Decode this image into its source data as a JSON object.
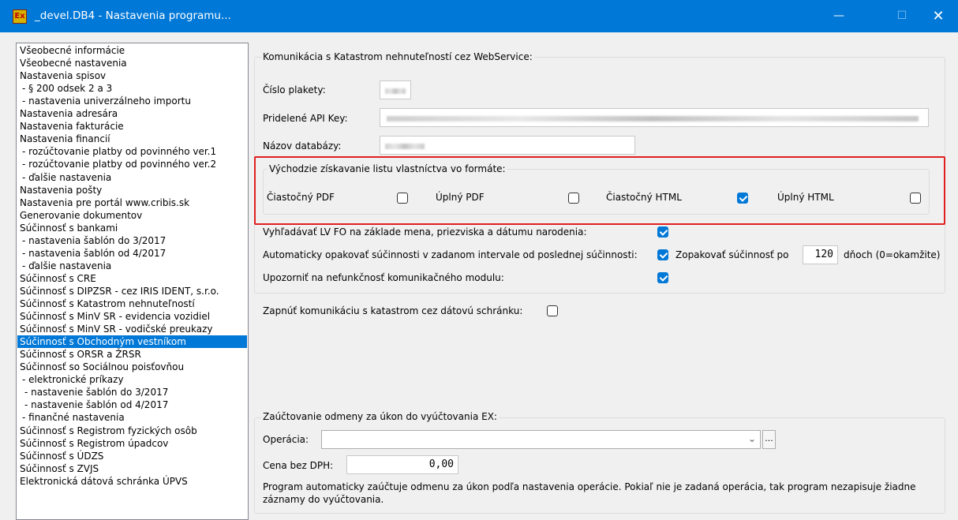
{
  "window": {
    "title": "_devel.DB4 - Nastavenia programu...",
    "icon_text": "Ex",
    "minimize_glyph": "—",
    "maximize_glyph": "☐",
    "close_glyph": "✕"
  },
  "tree": {
    "selected_index": 23,
    "items": [
      {
        "label": "Všeobecné informácie",
        "indent": 0
      },
      {
        "label": "Všeobecné nastavenia",
        "indent": 0
      },
      {
        "label": "Nastavenia spisov",
        "indent": 0
      },
      {
        "label": "- § 200 odsek 2 a 3",
        "indent": 1
      },
      {
        "label": "- nastavenia univerzálneho importu",
        "indent": 1
      },
      {
        "label": "Nastavenia adresára",
        "indent": 0
      },
      {
        "label": "Nastavenia fakturácie",
        "indent": 0
      },
      {
        "label": "Nastavenia financií",
        "indent": 0
      },
      {
        "label": "- rozúčtovanie platby od povinného ver.1",
        "indent": 1
      },
      {
        "label": "- rozúčtovanie platby od povinného ver.2",
        "indent": 1
      },
      {
        "label": "- ďalšie nastavenia",
        "indent": 1
      },
      {
        "label": "Nastavenia pošty",
        "indent": 0
      },
      {
        "label": "Nastavenia pre portál www.cribis.sk",
        "indent": 0
      },
      {
        "label": "Generovanie dokumentov",
        "indent": 0
      },
      {
        "label": "Súčinnosť s bankami",
        "indent": 0
      },
      {
        "label": "- nastavenia šablón do 3/2017",
        "indent": 1
      },
      {
        "label": "- nastavenia šablón od 4/2017",
        "indent": 1
      },
      {
        "label": "- ďalšie nastavenia",
        "indent": 1
      },
      {
        "label": "Súčinnosť s CRE",
        "indent": 0
      },
      {
        "label": "Súčinnosť s DIPZSR - cez IRIS IDENT, s.r.o.",
        "indent": 0
      },
      {
        "label": "Súčinnosť s Katastrom nehnuteľností",
        "indent": 0
      },
      {
        "label": "Súčinnosť s MinV SR - evidencia vozidiel",
        "indent": 0
      },
      {
        "label": "Súčinnosť s MinV SR - vodičské preukazy",
        "indent": 0
      },
      {
        "label": "Súčinnosť s Obchodným vestníkom",
        "indent": 0
      },
      {
        "label": "Súčinnosť s ORSR a ŽRSR",
        "indent": 0
      },
      {
        "label": "Súčinnosť so Sociálnou poisťovňou",
        "indent": 0
      },
      {
        "label": "- elektronické príkazy",
        "indent": 1
      },
      {
        "label": "- nastavenie šablón do 3/2017",
        "indent": 2
      },
      {
        "label": "- nastavenie šablón od 4/2017",
        "indent": 2
      },
      {
        "label": "- finančné nastavenia",
        "indent": 1
      },
      {
        "label": "Súčinnosť s Registrom fyzických osôb",
        "indent": 0
      },
      {
        "label": "Súčinnosť s Registrom úpadcov",
        "indent": 0
      },
      {
        "label": "Súčinnosť s ÚDZS",
        "indent": 0
      },
      {
        "label": "Súčinnosť s ZVJS",
        "indent": 0
      },
      {
        "label": "Elektronická dátová schránka ÚPVS",
        "indent": 0
      }
    ]
  },
  "webservice": {
    "legend": "Komunikácia s Katastrom nehnuteľností cez WebService:",
    "plaketa_label": "Číslo plakety:",
    "api_key_label": "Pridelené API Key:",
    "db_label": "Názov databázy:",
    "format_group": {
      "legend": "Východzie získavanie listu vlastníctva vo formáte:",
      "options": [
        {
          "label": "Čiastočný PDF",
          "checked": false
        },
        {
          "label": "Úplný PDF",
          "checked": false
        },
        {
          "label": "Čiastočný HTML",
          "checked": true
        },
        {
          "label": "Úplný HTML",
          "checked": false
        }
      ]
    },
    "search_lv_label": "Vyhľadávať LV FO na základe mena, priezviska a dátumu narodenia:",
    "search_lv_checked": true,
    "auto_repeat_label": "Automaticky opakovať súčinnosti v zadanom intervale od poslednej súčinnosti:",
    "auto_repeat_checked": true,
    "repeat_after_label": "Zopakovať súčinnosť po",
    "repeat_days": "120",
    "repeat_days_suffix": "dňoch (0=okamžite)",
    "notify_label": "Upozorniť na nefunkčnosť komunikačného modulu:",
    "notify_checked": true
  },
  "databox": {
    "label": "Zapnúť komunikáciu s katastrom cez dátovú schránku:",
    "checked": false
  },
  "billing": {
    "legend": "Zaúčtovanie odmeny za úkon do vyúčtovania EX:",
    "operation_label": "Operácia:",
    "operation_value": "",
    "ellipsis": "...",
    "price_label": "Cena bez DPH:",
    "price_value": "0,00",
    "note": "Program automaticky zaúčtuje odmenu za úkon podľa nastavenia operácie. Pokiaľ nie je zadaná operácia, tak program nezapisuje žiadne záznamy do vyúčtovania."
  },
  "colors": {
    "accent": "#0078d7",
    "highlight": "#e02020"
  }
}
